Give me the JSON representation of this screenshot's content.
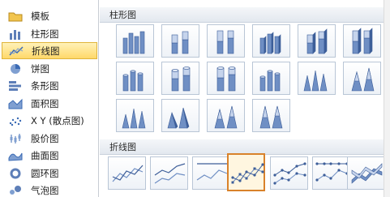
{
  "sidebar": {
    "items": [
      {
        "label": "模板",
        "icon": "folder-icon"
      },
      {
        "label": "柱形图",
        "icon": "column-chart-icon"
      },
      {
        "label": "折线图",
        "icon": "line-chart-icon",
        "selected": true
      },
      {
        "label": "饼图",
        "icon": "pie-chart-icon"
      },
      {
        "label": "条形图",
        "icon": "bar-chart-icon"
      },
      {
        "label": "面积图",
        "icon": "area-chart-icon"
      },
      {
        "label": "X Y (散点图)",
        "icon": "scatter-chart-icon"
      },
      {
        "label": "股价图",
        "icon": "stock-chart-icon"
      },
      {
        "label": "曲面图",
        "icon": "surface-chart-icon"
      },
      {
        "label": "圆环图",
        "icon": "doughnut-chart-icon"
      },
      {
        "label": "气泡图",
        "icon": "bubble-chart-icon"
      }
    ]
  },
  "gallery": {
    "column_section_title": "柱形图",
    "line_section_title": "折线图",
    "column_rows": [
      [
        "clustered-column-icon",
        "stacked-column-icon",
        "100-stacked-column-icon",
        "3d-clustered-column-icon",
        "3d-stacked-column-icon",
        "3d-100-stacked-column-icon",
        "3d-column-icon"
      ],
      [
        "clustered-cylinder-icon",
        "stacked-cylinder-icon",
        "100-stacked-cylinder-icon",
        "3d-cylinder-icon",
        "clustered-cone-icon",
        "stacked-cone-icon",
        "100-stacked-cone-icon"
      ],
      [
        "3d-cone-icon",
        "clustered-pyramid-icon",
        "stacked-pyramid-icon",
        "100-stacked-pyramid-icon"
      ]
    ],
    "line_row": [
      "line-icon",
      "stacked-line-icon",
      "100-stacked-line-icon",
      "line-with-markers-icon",
      "stacked-line-with-markers-icon",
      "100-stacked-line-with-markers-icon",
      "3d-line-icon"
    ],
    "selected_line_index": 3
  },
  "colors": {
    "selection_fill": "#ffd86a",
    "selection_border": "#d9822b",
    "chart_blue": "#6f8fc4"
  }
}
